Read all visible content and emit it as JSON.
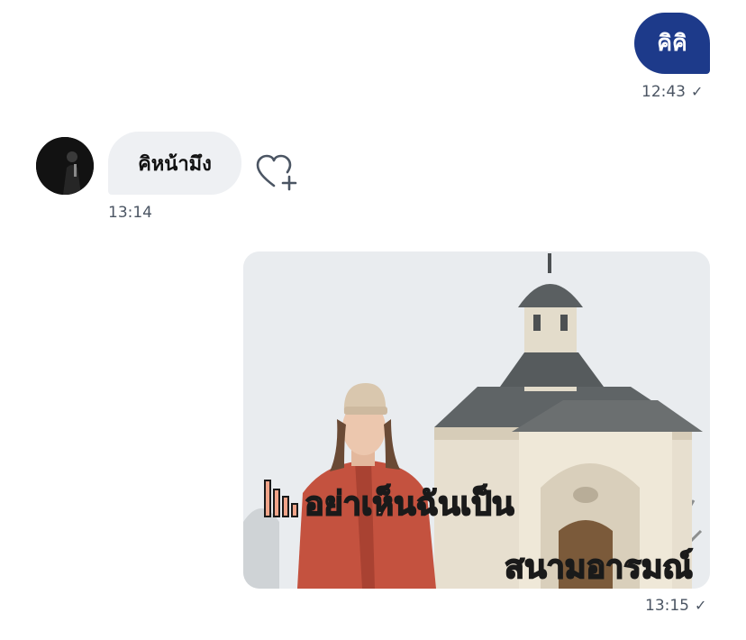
{
  "messages": {
    "first_outgoing": {
      "text": "คิคิ",
      "time": "12:43",
      "status": "✓"
    },
    "incoming": {
      "text": "คิหน้ามึง",
      "time": "13:14"
    },
    "image_outgoing": {
      "caption_line1": "อย่าเห็นฉันเป็น",
      "caption_line2": "สนามอารมณ์",
      "time": "13:15",
      "status": "✓"
    }
  },
  "icons": {
    "react": "heart-plus-icon",
    "read_receipt": "check-icon"
  },
  "colors": {
    "outgoing_bubble": "#1d3a8a",
    "incoming_bubble": "#eef0f3",
    "caption_fill": "#f1a489",
    "caption_stroke": "#1a1a1a"
  }
}
